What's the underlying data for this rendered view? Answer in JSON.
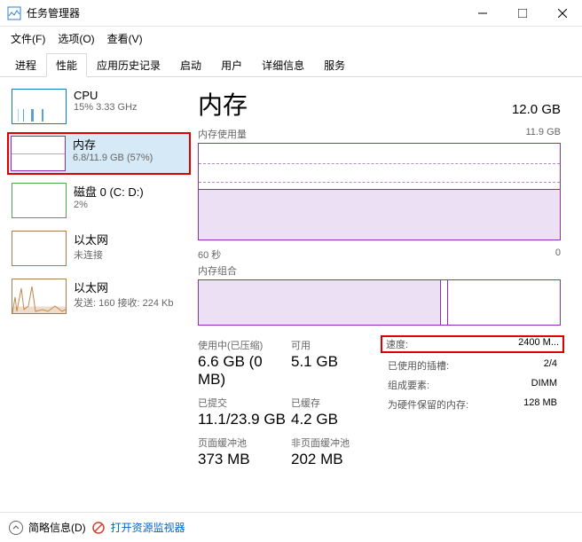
{
  "window": {
    "title": "任务管理器"
  },
  "menu": {
    "file": "文件(F)",
    "options": "选项(O)",
    "view": "查看(V)"
  },
  "tabs": {
    "processes": "进程",
    "performance": "性能",
    "history": "应用历史记录",
    "startup": "启动",
    "users": "用户",
    "details": "详细信息",
    "services": "服务"
  },
  "sidebar": {
    "cpu": {
      "title": "CPU",
      "sub": "15% 3.33 GHz"
    },
    "memory": {
      "title": "内存",
      "sub": "6.8/11.9 GB (57%)"
    },
    "disk": {
      "title": "磁盘 0 (C: D:)",
      "sub": "2%"
    },
    "eth1": {
      "title": "以太网",
      "sub": "未连接"
    },
    "eth2": {
      "title": "以太网",
      "sub": "发送: 160 接收: 224 Kb"
    }
  },
  "detail": {
    "title": "内存",
    "capacity": "12.0 GB",
    "usage_label": "内存使用量",
    "usage_max": "11.9 GB",
    "x_label": "60 秒",
    "x_right": "0",
    "composition_label": "内存组合",
    "stats": {
      "in_use_label": "使用中(已压缩)",
      "in_use": "6.6 GB (0 MB)",
      "available_label": "可用",
      "available": "5.1 GB",
      "committed_label": "已提交",
      "committed": "11.1/23.9 GB",
      "cached_label": "已缓存",
      "cached": "4.2 GB",
      "paged_label": "页面缓冲池",
      "paged": "373 MB",
      "nonpaged_label": "非页面缓冲池",
      "nonpaged": "202 MB"
    },
    "kv": {
      "speed_k": "速度:",
      "speed_v": "2400 M...",
      "slots_k": "已使用的插槽:",
      "slots_v": "2/4",
      "form_k": "组成要素:",
      "form_v": "DIMM",
      "reserved_k": "为硬件保留的内存:",
      "reserved_v": "128 MB"
    }
  },
  "footer": {
    "simple": "简略信息(D)",
    "monitor": "打开资源监视器"
  },
  "chart_data": {
    "type": "area",
    "title": "内存使用量",
    "xlabel": "60 秒",
    "ylabel": "GB",
    "ylim": [
      0,
      11.9
    ],
    "x": [
      60,
      55,
      50,
      45,
      40,
      35,
      30,
      25,
      20,
      15,
      10,
      5,
      0
    ],
    "values": [
      6.3,
      6.3,
      6.3,
      6.3,
      6.3,
      6.3,
      6.3,
      6.3,
      6.3,
      6.3,
      6.3,
      6.3,
      6.3
    ]
  }
}
